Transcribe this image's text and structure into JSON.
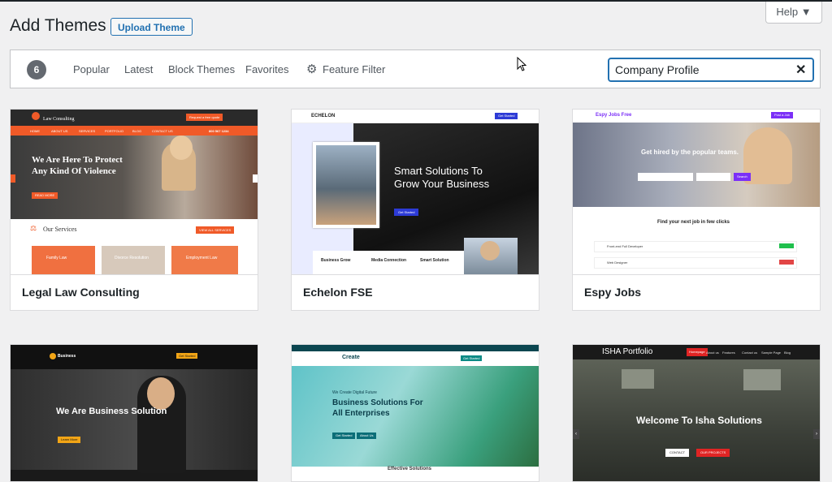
{
  "header": {
    "title": "Add Themes",
    "upload_label": "Upload Theme",
    "help_label": "Help ▼"
  },
  "filters": {
    "count": "6",
    "tabs": [
      "Popular",
      "Latest",
      "Block Themes",
      "Favorites"
    ],
    "feature_filter": "Feature Filter",
    "search_value": "Company Profile",
    "clear_icon": "✕"
  },
  "themes": [
    {
      "name": "Legal Law Consulting",
      "brand": "Law Consulting",
      "cta": "Request a free quote",
      "nav": [
        "HOME",
        "ABOUT US",
        "SERVICES",
        "PORTFOLIO",
        "BLOG",
        "CONTACT US"
      ],
      "phone": "800 567 1234",
      "hero_line1": "We Are Here To Protect",
      "hero_line2": "Any Kind Of Violence",
      "hero_btn": "READ MORE",
      "services_title": "Our Services",
      "view_all": "VIEW ALL SERVICES",
      "service_items": [
        "Family Law",
        "Divorce Resolution",
        "Employment Law"
      ]
    },
    {
      "name": "Echelon FSE",
      "brand": "ECHELON",
      "nav_btn": "Get Started",
      "heading1": "Smart Solutions To",
      "heading2": "Grow Your Business",
      "btn": "Get Started",
      "features": [
        "Business Grow",
        "Media Connection",
        "Smart Solution"
      ]
    },
    {
      "name": "Espy Jobs",
      "brand": "Espy Jobs Free",
      "nav_btn": "Post a Job",
      "hero": "Get hired by the popular teams.",
      "search_btn": "Search",
      "section": "Find your next job in few clicks",
      "jobs": [
        "Front-end Full Developer",
        "Web Designer"
      ]
    },
    {
      "brand": "Business",
      "nav_btn": "Get Started",
      "heading": "We Are Business Solution",
      "btn": "Learn More"
    },
    {
      "brand": "Create",
      "nav_btn": "Get Started",
      "kicker": "We Create Digital Future",
      "heading1": "Business Solutions For",
      "heading2": "All Enterprises",
      "btn1": "Get Started",
      "btn2": "About Us",
      "footer": "Effective Solutions"
    },
    {
      "brand": "ISHA Portfolio",
      "nav": [
        "Homepage",
        "About us",
        "Features",
        "Contact us",
        "Sample Page",
        "Blog"
      ],
      "heading": "Welcome To Isha Solutions",
      "btn1": "CONTACT",
      "btn2": "OUR PROJECTS"
    }
  ],
  "colors": {
    "accent": "#2271b1",
    "law_orange": "#f05a28",
    "jobs_purple": "#7b2ff7",
    "isha_red": "#e02424"
  }
}
